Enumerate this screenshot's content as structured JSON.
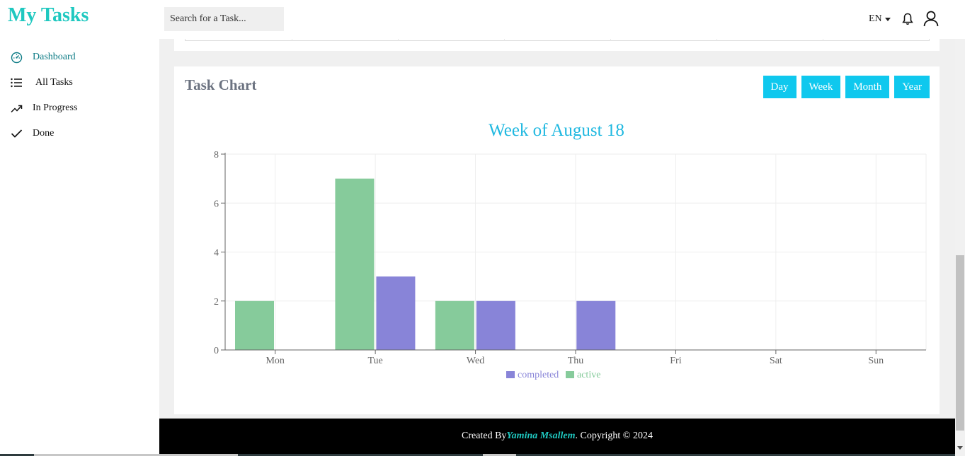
{
  "app": {
    "title": "My Tasks"
  },
  "sidebar": {
    "items": [
      {
        "label": "Dashboard",
        "icon": "dashboard-gauge-icon",
        "active": true
      },
      {
        "label": "All Tasks",
        "icon": "list-icon",
        "active": false
      },
      {
        "label": "In Progress",
        "icon": "trending-up-icon",
        "active": false
      },
      {
        "label": "Done",
        "icon": "check-icon",
        "active": false
      }
    ]
  },
  "header": {
    "search_placeholder": "Search for a Task...",
    "language": "EN",
    "icons": [
      "bell-icon",
      "user-icon"
    ]
  },
  "task_chart": {
    "title": "Task Chart",
    "range_buttons": [
      "Day",
      "Week",
      "Month",
      "Year"
    ]
  },
  "chart_data": {
    "type": "bar",
    "title": "Week of August 18",
    "categories": [
      "Mon",
      "Tue",
      "Wed",
      "Thu",
      "Fri",
      "Sat",
      "Sun"
    ],
    "series": [
      {
        "name": "active",
        "color": "#86cb9b",
        "values": [
          2,
          7,
          2,
          0,
          0,
          0,
          0
        ]
      },
      {
        "name": "completed",
        "color": "#8884d8",
        "values": [
          0,
          3,
          2,
          2,
          0,
          0,
          0
        ]
      }
    ],
    "legend_order": [
      "completed",
      "active"
    ],
    "yticks": [
      0,
      2,
      4,
      6,
      8
    ],
    "ylim": [
      0,
      8
    ],
    "grid": true,
    "legend_position": "bottom-center"
  },
  "footer": {
    "prefix": "Created By",
    "author": "Yamina Msallem",
    "suffix": ". Copyright © 2024"
  },
  "colors": {
    "brand": "#1fc8c0",
    "button": "#0fc8ee",
    "chart_title": "#1fb8e0",
    "active_nav": "#0e7c86"
  }
}
